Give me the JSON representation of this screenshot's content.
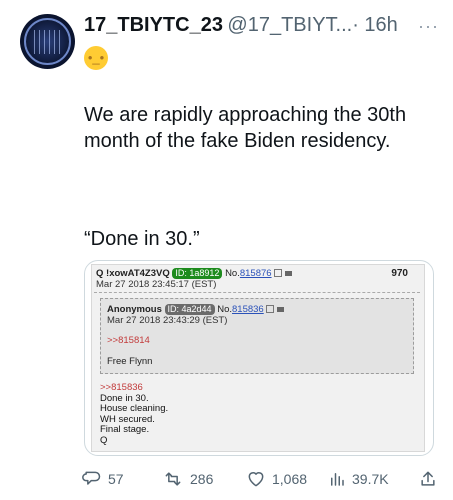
{
  "tweet": {
    "display_name": "17_TBIYTC_23",
    "handle": "@17_TBIYT...",
    "time": "· 16h",
    "emoji": "🧐",
    "body_p1": "We are rapidly approaching the 30th month of the fake Biden residency.",
    "body_p2": "“Done in 30.”",
    "more_label": "···"
  },
  "card": {
    "op": {
      "name": "Q !xowAT4Z3VQ",
      "id": "ID: 1a8912",
      "no_prefix": "No.",
      "no_link": "815876",
      "date": "Mar 27 2018 23:45:17 (EST)",
      "number": "970",
      "lines": [
        ">>815836",
        "Done in 30.",
        "House cleaning.",
        "WH secured.",
        "Final stage.",
        "Q"
      ]
    },
    "reply": {
      "name": "Anonymous",
      "id": "ID: 4a2d44",
      "no_prefix": "No.",
      "no_link": "815836",
      "date": "Mar 27 2018 23:43:29 (EST)",
      "ref": ">>815814",
      "text": "Free Flynn"
    }
  },
  "actions": {
    "replies": "57",
    "retweets": "286",
    "likes": "1,068",
    "views": "39.7K"
  },
  "colors": {
    "id_green": "#1d8b1d",
    "id_gray": "#6b6b6b",
    "link": "#2b52b9",
    "greentext_red": "#c23b3b"
  }
}
